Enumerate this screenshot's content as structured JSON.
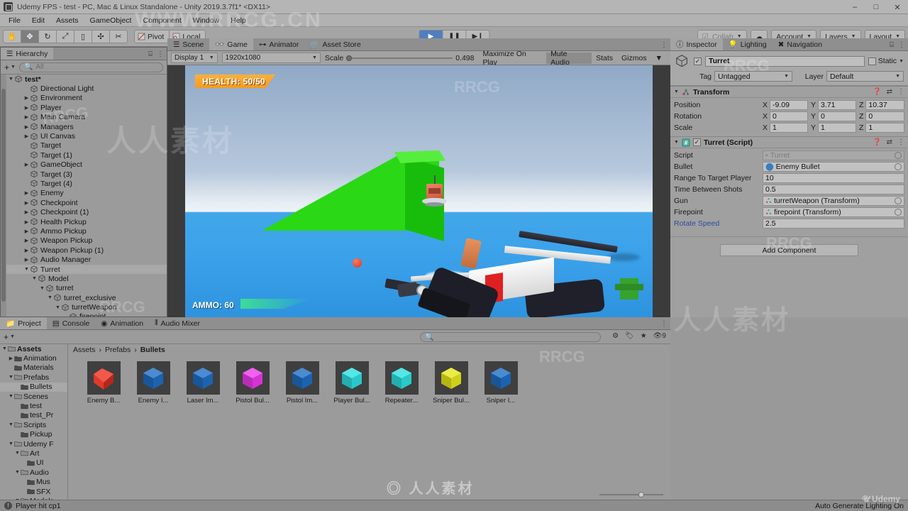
{
  "window": {
    "title": "Udemy FPS - test - PC, Mac & Linux Standalone - Unity 2019.3.7f1* <DX11>",
    "minimize": "–",
    "maximize": "□",
    "close": "✕"
  },
  "menubar": {
    "items": [
      "File",
      "Edit",
      "Assets",
      "GameObject",
      "Component",
      "Window",
      "Help"
    ]
  },
  "toolbar": {
    "tools": [
      {
        "name": "hand-tool",
        "glyph": "✋",
        "active": false
      },
      {
        "name": "move-tool",
        "glyph": "✥",
        "active": true
      },
      {
        "name": "rotate-tool",
        "glyph": "↻",
        "active": false
      },
      {
        "name": "scale-tool",
        "glyph": "⤢",
        "active": false
      },
      {
        "name": "rect-tool",
        "glyph": "▯",
        "active": false
      },
      {
        "name": "transform-tool",
        "glyph": "✣",
        "active": false
      },
      {
        "name": "custom-tool",
        "glyph": "✂",
        "active": false
      }
    ],
    "pivot_label": "Pivot",
    "local_label": "Local",
    "play_controls": [
      {
        "name": "play-button",
        "glyph": "▶",
        "playing": true
      },
      {
        "name": "pause-button",
        "glyph": "❚❚",
        "playing": false
      },
      {
        "name": "step-button",
        "glyph": "▶❙",
        "playing": false
      }
    ],
    "collab_label": "Collab",
    "cloud_label": "☁",
    "account_label": "Account",
    "layers_label": "Layers",
    "layout_label": "Layout"
  },
  "hierarchy": {
    "tab_label": "Hierarchy",
    "search_placeholder": "All",
    "add_label": "+",
    "items": [
      {
        "label": "test*",
        "depth": 0,
        "arrow": "down",
        "root": true,
        "selected": false
      },
      {
        "label": "Directional Light",
        "depth": 2,
        "arrow": "none"
      },
      {
        "label": "Environment",
        "depth": 2,
        "arrow": "right"
      },
      {
        "label": "Player",
        "depth": 2,
        "arrow": "right"
      },
      {
        "label": "Main Camera",
        "depth": 2,
        "arrow": "right"
      },
      {
        "label": "Managers",
        "depth": 2,
        "arrow": "right"
      },
      {
        "label": "UI Canvas",
        "depth": 2,
        "arrow": "right"
      },
      {
        "label": "Target",
        "depth": 2,
        "arrow": "none"
      },
      {
        "label": "Target (1)",
        "depth": 2,
        "arrow": "none"
      },
      {
        "label": "GameObject",
        "depth": 2,
        "arrow": "right"
      },
      {
        "label": "Target (3)",
        "depth": 2,
        "arrow": "none"
      },
      {
        "label": "Target (4)",
        "depth": 2,
        "arrow": "none"
      },
      {
        "label": "Enemy",
        "depth": 2,
        "arrow": "right"
      },
      {
        "label": "Checkpoint",
        "depth": 2,
        "arrow": "right"
      },
      {
        "label": "Checkpoint (1)",
        "depth": 2,
        "arrow": "right"
      },
      {
        "label": "Health Pickup",
        "depth": 2,
        "arrow": "right"
      },
      {
        "label": "Ammo Pickup",
        "depth": 2,
        "arrow": "right"
      },
      {
        "label": "Weapon Pickup",
        "depth": 2,
        "arrow": "right"
      },
      {
        "label": "Weapon Pickup (1)",
        "depth": 2,
        "arrow": "right"
      },
      {
        "label": "Audio Manager",
        "depth": 2,
        "arrow": "right"
      },
      {
        "label": "Turret",
        "depth": 2,
        "arrow": "down",
        "selected": true
      },
      {
        "label": "Model",
        "depth": 3,
        "arrow": "down"
      },
      {
        "label": "turret",
        "depth": 4,
        "arrow": "down"
      },
      {
        "label": "turret_exclusive",
        "depth": 5,
        "arrow": "down"
      },
      {
        "label": "turretWeapon",
        "depth": 6,
        "arrow": "down"
      },
      {
        "label": "firepoint",
        "depth": 7,
        "arrow": "none"
      }
    ]
  },
  "gameview": {
    "tabs": [
      {
        "label": "Scene",
        "icon": "scene-icon",
        "active": false
      },
      {
        "label": "Game",
        "icon": "game-icon",
        "active": true
      },
      {
        "label": "Animator",
        "icon": "animator-icon",
        "active": false
      },
      {
        "label": "Asset Store",
        "icon": "store-icon",
        "active": false
      }
    ],
    "display_label": "Display 1",
    "resolution_label": "1920x1080",
    "scale_label": "Scale",
    "scale_value": "0.498",
    "maximize_label": "Maximize On Play",
    "mute_label": "Mute Audio",
    "stats_label": "Stats",
    "gizmos_label": "Gizmos",
    "hud": {
      "health": "HEALTH: 50/50",
      "ammo": "AMMO: 60"
    }
  },
  "inspector": {
    "tabs": [
      {
        "label": "Inspector",
        "active": true
      },
      {
        "label": "Lighting",
        "active": false
      },
      {
        "label": "Navigation",
        "active": false
      }
    ],
    "object_name": "Turret",
    "enabled": true,
    "static_label": "Static",
    "tag_label": "Tag",
    "tag_value": "Untagged",
    "layer_label": "Layer",
    "layer_value": "Default",
    "transform": {
      "title": "Transform",
      "rows": [
        {
          "label": "Position",
          "x": "-9.09",
          "y": "3.71",
          "z": "10.37"
        },
        {
          "label": "Rotation",
          "x": "0",
          "y": "0",
          "z": "0"
        },
        {
          "label": "Scale",
          "x": "1",
          "y": "1",
          "z": "1"
        }
      ],
      "axis_labels": [
        "X",
        "Y",
        "Z"
      ]
    },
    "script_component": {
      "title": "Turret (Script)",
      "enabled": true,
      "fields": [
        {
          "label": "Script",
          "value": "Turret",
          "kind": "object",
          "dimmed": true
        },
        {
          "label": "Bullet",
          "value": "Enemy Bullet",
          "kind": "object",
          "dimmed": false
        },
        {
          "label": "Range To Target Player",
          "value": "10",
          "kind": "text"
        },
        {
          "label": "Time Between Shots",
          "value": "0.5",
          "kind": "text"
        },
        {
          "label": "Gun",
          "value": "turretWeapon (Transform)",
          "kind": "object"
        },
        {
          "label": "Firepoint",
          "value": "firepoint (Transform)",
          "kind": "object"
        },
        {
          "label": "Rotate Speed",
          "value": "2.5",
          "kind": "text",
          "link": true
        }
      ]
    },
    "add_component_label": "Add Component"
  },
  "project": {
    "tabs": [
      {
        "label": "Project",
        "active": true
      },
      {
        "label": "Console",
        "active": false
      },
      {
        "label": "Animation",
        "active": false
      },
      {
        "label": "Audio Mixer",
        "active": false
      }
    ],
    "add_label": "+",
    "search_placeholder": "",
    "breadcrumbs": [
      "Assets",
      "Prefabs",
      "Bullets"
    ],
    "tree": [
      {
        "label": "Assets",
        "depth": 0,
        "arrow": "down",
        "bold": true
      },
      {
        "label": "Animation",
        "depth": 1,
        "arrow": "right"
      },
      {
        "label": "Materials",
        "depth": 1,
        "arrow": "none"
      },
      {
        "label": "Prefabs",
        "depth": 1,
        "arrow": "down"
      },
      {
        "label": "Bullets",
        "depth": 2,
        "arrow": "none",
        "selected": true
      },
      {
        "label": "Scenes",
        "depth": 1,
        "arrow": "down"
      },
      {
        "label": "test",
        "depth": 2,
        "arrow": "none"
      },
      {
        "label": "test_Pr",
        "depth": 2,
        "arrow": "none"
      },
      {
        "label": "Scripts",
        "depth": 1,
        "arrow": "down"
      },
      {
        "label": "Pickup",
        "depth": 2,
        "arrow": "none"
      },
      {
        "label": "Udemy F",
        "depth": 1,
        "arrow": "down"
      },
      {
        "label": "Art",
        "depth": 2,
        "arrow": "down"
      },
      {
        "label": "UI",
        "depth": 3,
        "arrow": "none"
      },
      {
        "label": "Audio",
        "depth": 2,
        "arrow": "down"
      },
      {
        "label": "Mus",
        "depth": 3,
        "arrow": "none"
      },
      {
        "label": "SFX",
        "depth": 3,
        "arrow": "none"
      },
      {
        "label": "Models",
        "depth": 2,
        "arrow": "down"
      }
    ],
    "assets": [
      {
        "label": "Enemy B...",
        "color": "#e03a2a",
        "type": "prefab-red"
      },
      {
        "label": "Enemy I...",
        "color": "#1f6fc4",
        "type": "prefab-blue"
      },
      {
        "label": "Laser Im...",
        "color": "#1f6fc4",
        "type": "prefab-blue"
      },
      {
        "label": "Pistol Bul...",
        "color": "#ec3aec",
        "type": "prefab-magenta"
      },
      {
        "label": "Pistol Im...",
        "color": "#1f6fc4",
        "type": "prefab-blue"
      },
      {
        "label": "Player Bul...",
        "color": "#2ee0e0",
        "type": "prefab-cyan"
      },
      {
        "label": "Repeater...",
        "color": "#2ee0e0",
        "type": "prefab-cyan"
      },
      {
        "label": "Sniper Bul...",
        "color": "#e8e81c",
        "type": "prefab-yellow"
      },
      {
        "label": "Sniper I...",
        "color": "#1f6fc4",
        "type": "prefab-blue"
      }
    ]
  },
  "statusbar": {
    "message": "Player hit cp1",
    "lighting": "Auto Generate Lighting On",
    "brand": "Udemy"
  },
  "colors": {
    "accent_play": "#4f7fbf",
    "health_bar": "#f5a623",
    "selection": "#a8a8a8",
    "panel_bg": "#9b9b9b"
  }
}
